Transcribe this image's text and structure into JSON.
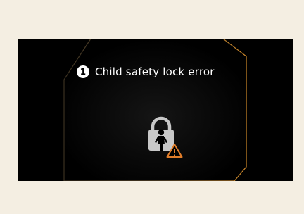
{
  "message": {
    "number": "1",
    "text": "Child safety lock error"
  },
  "icons": {
    "main": "child-safety-lock-icon",
    "warning": "warning-triangle-icon"
  },
  "colors": {
    "background": "#000000",
    "frame_accent": "#d08a2a",
    "warning": "#e07d2a",
    "icon_gray": "#c8c8c8"
  }
}
